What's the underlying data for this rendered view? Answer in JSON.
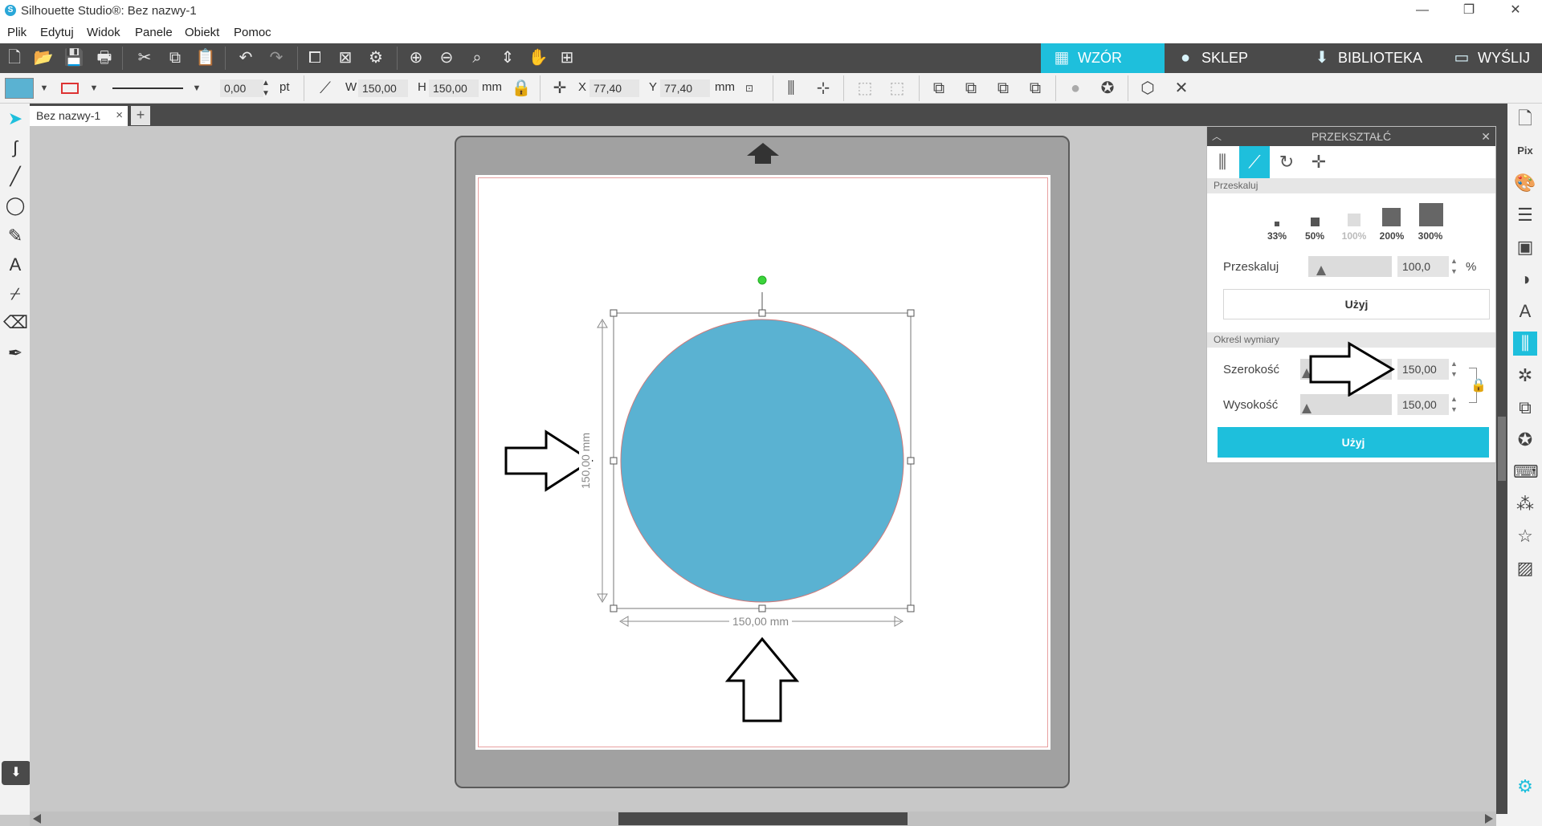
{
  "window": {
    "title": "Silhouette Studio®: Bez nazwy-1",
    "logo_glyph": "S",
    "minimize": "—",
    "restore": "❐",
    "close": "✕"
  },
  "menu": {
    "items": [
      "Plik",
      "Edytuj",
      "Widok",
      "Panele",
      "Obiekt",
      "Pomoc"
    ]
  },
  "nav_tabs": [
    {
      "label": "WZÓR",
      "icon": "grid-icon"
    },
    {
      "label": "SKLEP",
      "icon": "store-icon"
    },
    {
      "label": "BIBLIOTEKA",
      "icon": "library-icon"
    },
    {
      "label": "WYŚLIJ",
      "icon": "send-icon"
    }
  ],
  "toolbar2": {
    "line_width_value": "0,00",
    "line_width_unit": "pt",
    "w_label": "W",
    "w_value": "150,00",
    "h_label": "H",
    "h_value": "150,00",
    "size_unit": "mm",
    "x_label": "X",
    "x_value": "77,40",
    "y_label": "Y",
    "y_value": "77,40",
    "pos_unit": "mm",
    "fill_color": "#5ab2d2",
    "stroke_color": "#d33"
  },
  "doc_tab": {
    "label": "Bez nazwy-1",
    "close": "×",
    "add": "+"
  },
  "canvas": {
    "shape_color": "#5ab2d2",
    "dim_width": "150,00 mm",
    "dim_height": "150,00 mm"
  },
  "panel": {
    "title": "PRZEKSZTAŁĆ",
    "section_scale": "Przeskaluj",
    "scale_presets": [
      "33%",
      "50%",
      "100%",
      "200%",
      "300%"
    ],
    "scale_label": "Przeskaluj",
    "scale_value": "100,0",
    "scale_unit": "%",
    "apply1": "Użyj",
    "section_dims": "Określ wymiary",
    "width_label": "Szerokość",
    "width_value": "150,00",
    "height_label": "Wysokość",
    "height_value": "150,00",
    "apply2": "Użyj",
    "accent": "#1ebfdc"
  }
}
